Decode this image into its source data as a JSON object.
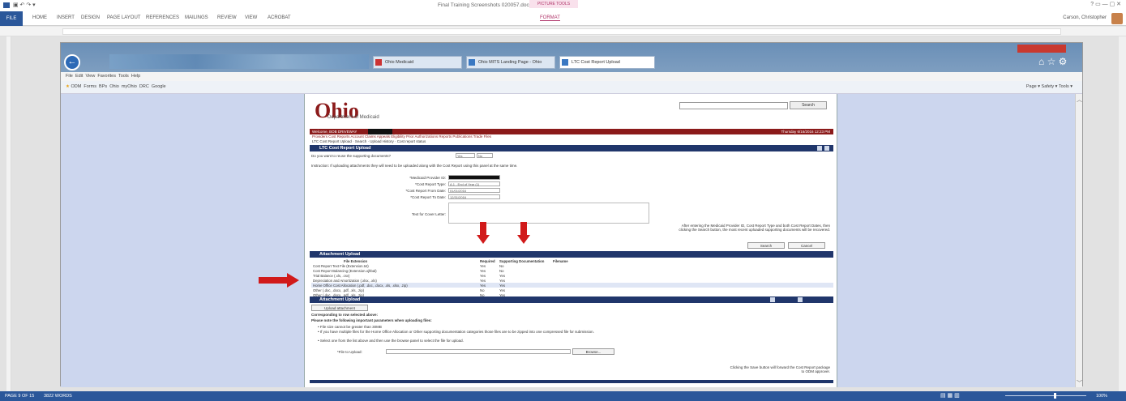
{
  "word": {
    "title": "Final Training Screenshots 020057.docx - Word",
    "picture_tools": "PICTURE TOOLS",
    "tabs": [
      "FILE",
      "HOME",
      "INSERT",
      "DESIGN",
      "PAGE LAYOUT",
      "REFERENCES",
      "MAILINGS",
      "REVIEW",
      "VIEW",
      "ACROBAT",
      "FORMAT"
    ],
    "user": "Carson, Christopher",
    "status_page": "PAGE 9 OF 15",
    "status_words": "3822 WORDS",
    "zoom": "100%"
  },
  "ie": {
    "tabs": [
      "Ohio Medicaid",
      "Ohio MITS Landing Page - Ohio",
      "LTC Cost Report Upload"
    ],
    "menu": [
      "File",
      "Edit",
      "View",
      "Favorites",
      "Tools",
      "Help"
    ],
    "favorites": [
      "ODM",
      "Forms",
      "BPs",
      "Ohio",
      "myOhio",
      "DRC",
      "Google"
    ],
    "command_bar": [
      "Page",
      "Safety",
      "Tools"
    ]
  },
  "ohio": {
    "logo": "Ohio",
    "dept": "Department of Medicaid",
    "search_button": "Search",
    "welcome": "Welcome, BOB DRIVEWAY",
    "welcome_right": "Thursday 6/16/2016 12:23 PM",
    "nav_links": "Providers  Cost Reports  Account  Claims  Appeals  Eligibility  Prior Authorizations  Reports  Publications  Trade Files",
    "breadcrumb": "LTC Cost Report Upload  ·  Search  ·  Upload History  ·  Cost report status"
  },
  "upload_form": {
    "header": "LTC Cost Report Upload",
    "question": "Do you want to reuse the supporting documents?",
    "instruction": "Instruction: If uploading attachments they will need to be uploaded along with the Cost Report using this panel at the same time.",
    "fields": [
      {
        "label": "*Medicaid Provider ID:",
        "value": ""
      },
      {
        "label": "*Cost Report Type:",
        "value": "A.1 - End of Year (1)"
      },
      {
        "label": "*Cost Report From Date:",
        "value": "01/01/2016"
      },
      {
        "label": "*Cost Report To Date:",
        "value": "12/31/2016"
      }
    ],
    "cover_letter_label": "Text for Cover Letter:",
    "hint": "After entering the Medicaid Provider ID, Cost Report Type and both Cost Report Dates, then clicking the Search button, the most recent uploaded supporting documents will be recovered.",
    "search": "Search",
    "cancel": "Cancel"
  },
  "attachment_upload": {
    "header": "Attachment Upload",
    "columns": [
      "File Extension",
      "Required",
      "Supporting Documentation",
      "Filename"
    ],
    "rows": [
      {
        "file": "Cost Report Text File (Extension.txt)",
        "required": "Yes",
        "supporting": "No",
        "hl": false
      },
      {
        "file": "Cost Report Balancing (Extension.ojhbal)",
        "required": "Yes",
        "supporting": "No",
        "hl": false
      },
      {
        "file": "Trial Balance (.xls, .csv)",
        "required": "Yes",
        "supporting": "Yes",
        "hl": false
      },
      {
        "file": "Depreciation and Amortization (.xlsx, .xls)",
        "required": "Yes",
        "supporting": "Yes",
        "hl": false
      },
      {
        "file": "Home Office Cost Allocation (.pdf, .doc, .docx, .xls, .xlsx, .zip)",
        "required": "Yes",
        "supporting": "Yes",
        "hl": true
      },
      {
        "file": "Other (.doc, .docx, .pdf, .xls, .zip)",
        "required": "No",
        "supporting": "Yes",
        "hl": false
      },
      {
        "file": "Other (.doc, .docx, .pdf, .xls, .zip)",
        "required": "No",
        "supporting": "Yes",
        "hl": false
      }
    ]
  },
  "attachment_upload2": {
    "header": "Attachment Upload",
    "upload_btn": "Upload attachment",
    "selected_label": "Corresponding to row selected above:",
    "note": "Please note the following important parameters when uploading files:",
    "bullets": [
      "File size cannot be greater than 30MB",
      "If you have multiple files for the Home Office Allocation or Other supporting documentation categories those files are to be zipped into one compressed file for submission.",
      "Select one from the list above and then use the browse panel to select the file for upload."
    ],
    "file_label": "*File to Upload:",
    "browse": "Browse...",
    "footer_note": "Clicking the Save button will forward the Cost Report package to ODM approver."
  }
}
